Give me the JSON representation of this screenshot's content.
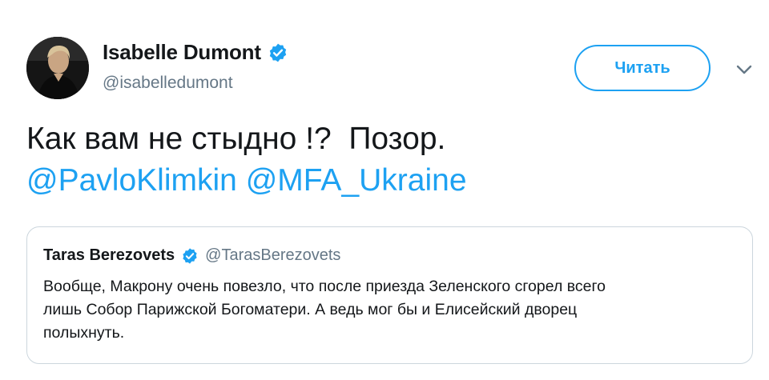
{
  "author": {
    "name": "Isabelle Dumont",
    "handle": "@isabelledumont",
    "avatar_icon": "profile-photo"
  },
  "follow_button": {
    "label": "Читать"
  },
  "menu_icon": "chevron-down-icon",
  "tweet": {
    "line1": "Как вам не стыдно !?  Позор.",
    "mention1": "@PavloKlimkin",
    "mention2": "@MFA_Ukraine"
  },
  "quoted_tweet": {
    "name": "Taras Berezovets",
    "handle": "@TarasBerezovets",
    "lines": [
      "Вообще, Макрону очень повезло, что после приезда Зеленского сгорел всего",
      "лишь Собор Парижской Богоматери. А ведь мог бы и Елисейский дворец",
      "полыхнуть."
    ]
  },
  "colors": {
    "accent": "#1da1f2",
    "text": "#14171a",
    "secondary": "#657786",
    "border": "#ccd6dd"
  }
}
